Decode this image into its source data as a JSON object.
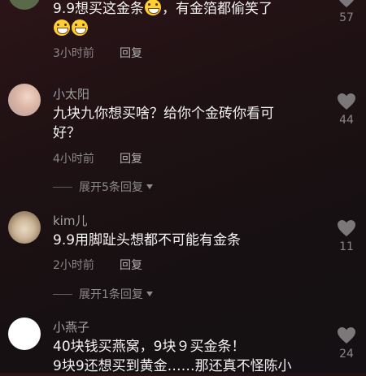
{
  "comments": [
    {
      "username": "",
      "text_before": "9.9想买这金条",
      "emoji1": "rofl-emoji",
      "text_after": "，有金箔都偷笑了",
      "emoji_line": [
        "grin-emoji",
        "grin-emoji"
      ],
      "time": "3小时前",
      "reply": "回复",
      "likes": "57"
    },
    {
      "username": "小太阳",
      "text_line1": "九块九你想买啥？给你个金砖你看可",
      "text_line2": "好？",
      "time": "4小时前",
      "reply": "回复",
      "expand": "展开5条回复",
      "likes": "44"
    },
    {
      "username": "kim儿",
      "text_line1": "9.9用脚趾头想都不可能有金条",
      "time": "2小时前",
      "reply": "回复",
      "expand": "展开1条回复",
      "likes": "11"
    },
    {
      "username": "小燕子",
      "text_line1": "40块钱买燕窝，9块９买金条！",
      "text_line2": "9块9还想买到黄金……那还真不怪陈小",
      "likes": "24"
    }
  ],
  "colors": {
    "heart": "#7c787a",
    "emoji": "#ffcf33"
  }
}
